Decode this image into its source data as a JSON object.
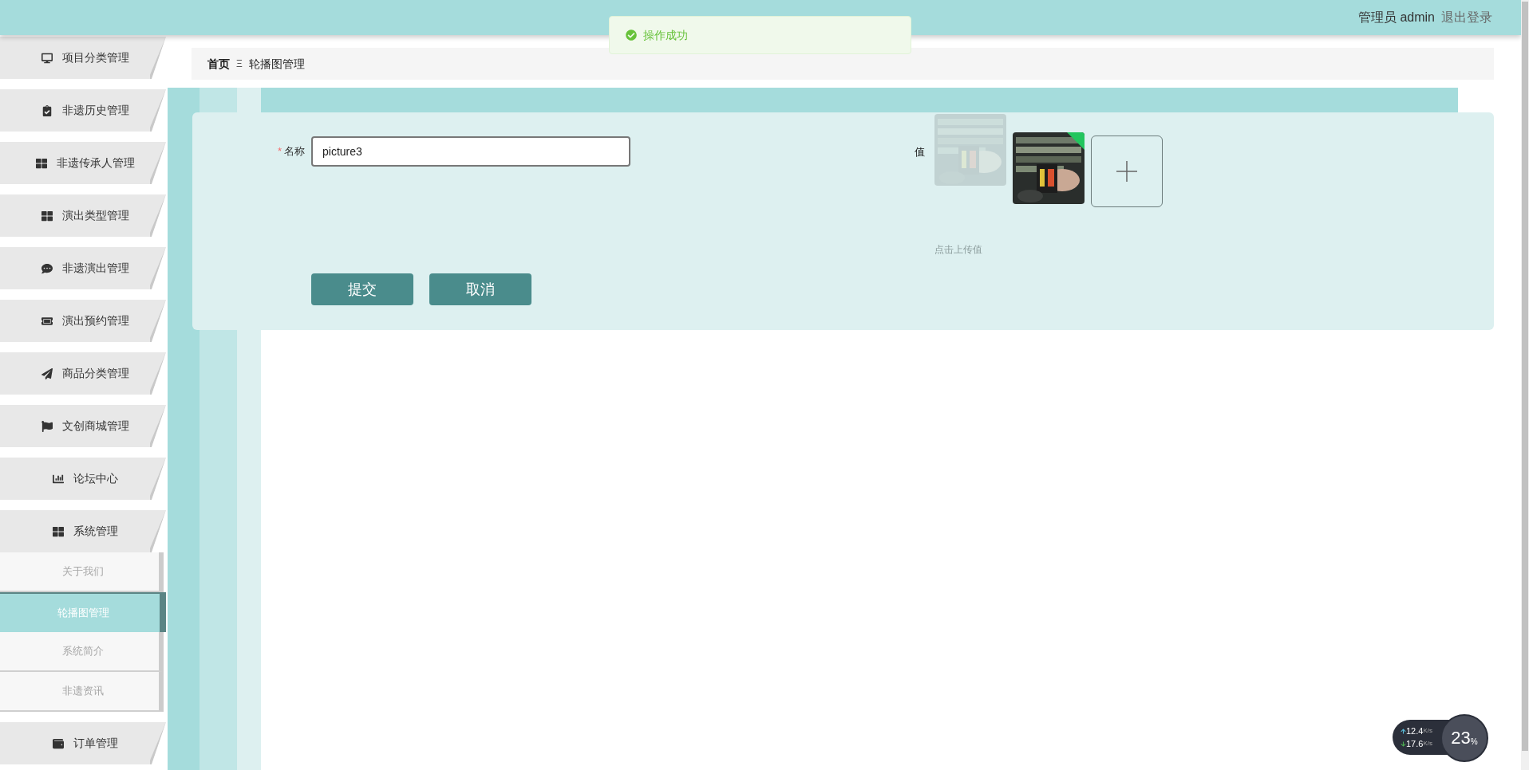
{
  "header": {
    "user": "管理员 admin",
    "logout": "退出登录"
  },
  "toast": {
    "message": "操作成功"
  },
  "sidebar": {
    "items": [
      {
        "label": "项目分类管理"
      },
      {
        "label": "非遗历史管理"
      },
      {
        "label": "非遗传承人管理"
      },
      {
        "label": "演出类型管理"
      },
      {
        "label": "非遗演出管理"
      },
      {
        "label": "演出预约管理"
      },
      {
        "label": "商品分类管理"
      },
      {
        "label": "文创商城管理"
      },
      {
        "label": "论坛中心"
      },
      {
        "label": "系统管理",
        "children": [
          {
            "label": "关于我们",
            "selected": false
          },
          {
            "label": "轮播图管理",
            "selected": true
          },
          {
            "label": "系统简介",
            "selected": false
          },
          {
            "label": "非遗资讯",
            "selected": false
          }
        ]
      },
      {
        "label": "订单管理"
      }
    ]
  },
  "breadcrumb": {
    "items": [
      "首页",
      "轮播图管理"
    ],
    "separator": "Ξ"
  },
  "form": {
    "required_mark": "*",
    "name_label": "名称",
    "name_value": "picture3",
    "value_label": "值",
    "upload_hint": "点击上传值",
    "images": [
      {
        "kind": "picture",
        "faded": true
      },
      {
        "kind": "picture",
        "faded": false
      }
    ],
    "buttons": [
      "提交",
      "取消"
    ]
  },
  "net_widget": {
    "upload": "12.4",
    "upload_unit": "K/s",
    "download": "17.6",
    "download_unit": "K/s",
    "load": "23",
    "percent": "%"
  }
}
